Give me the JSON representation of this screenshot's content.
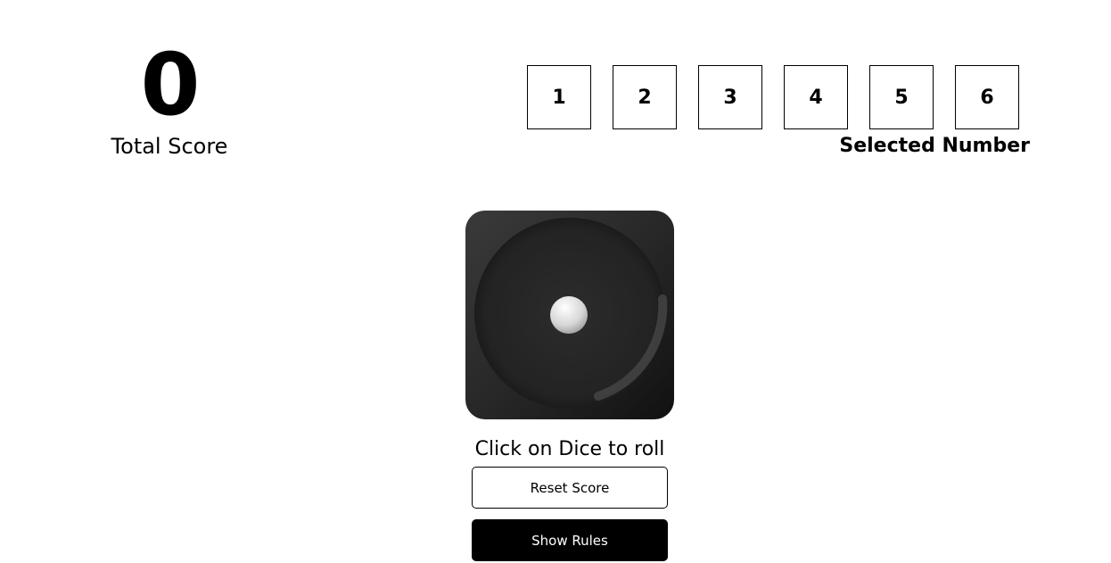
{
  "score": {
    "value": "0",
    "label": "Total Score"
  },
  "number_selector": {
    "numbers": [
      "1",
      "2",
      "3",
      "4",
      "5",
      "6"
    ],
    "label": "Selected Number"
  },
  "dice": {
    "face": "one-pip",
    "colors": {
      "body": "#1f1f1f",
      "pip": "#e6e6e6"
    }
  },
  "roll_hint": "Click on Dice to roll",
  "buttons": {
    "reset_label": "Reset Score",
    "rules_label": "Show Rules"
  }
}
